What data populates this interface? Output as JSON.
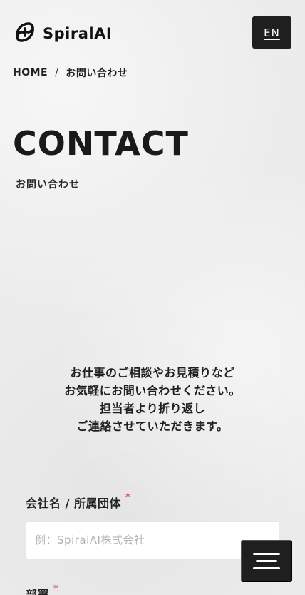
{
  "header": {
    "logo_text": "SpiralAI",
    "lang_button": "EN"
  },
  "breadcrumb": {
    "home": "HOME",
    "separator": "/",
    "current": "お問い合わせ"
  },
  "page": {
    "title": "CONTACT",
    "subtitle": "お問い合わせ"
  },
  "intro": {
    "lines": [
      "お仕事のご相談やお見積りなど",
      "お気軽にお問い合わせください。",
      "担当者より折り返し",
      "ご連絡させていただきます。"
    ]
  },
  "form": {
    "company": {
      "label": "会社名 / 所属団体",
      "required_mark": "*",
      "placeholder": "例：SpiralAI株式会社",
      "value": ""
    },
    "department": {
      "label": "部署",
      "required_mark": "*"
    }
  },
  "colors": {
    "dark": "#1f1f1f",
    "required": "#d9534f",
    "background": "#ececec"
  },
  "icons": {
    "logo": "spiral-logo-icon",
    "menu": "hamburger-menu-icon"
  }
}
